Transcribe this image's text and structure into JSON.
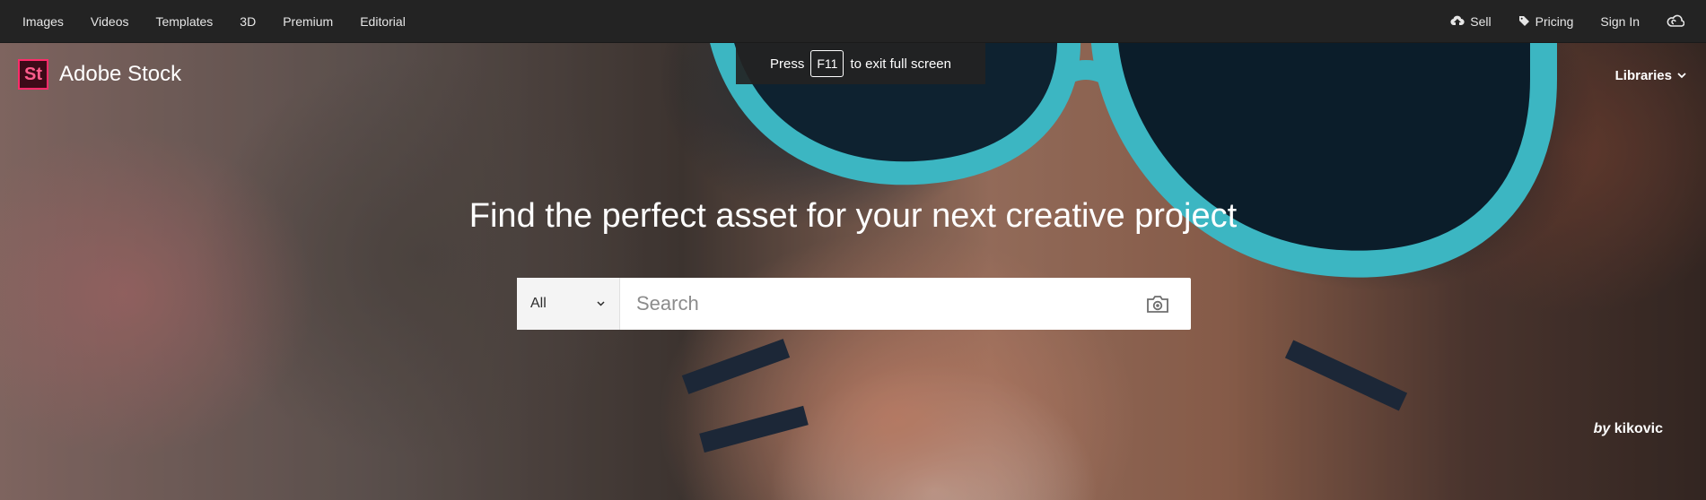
{
  "topnav": {
    "items": [
      "Images",
      "Videos",
      "Templates",
      "3D",
      "Premium",
      "Editorial"
    ]
  },
  "topright": {
    "sell": "Sell",
    "pricing": "Pricing",
    "signin": "Sign In",
    "icons": {
      "sell": "cloud-upload-icon",
      "pricing": "tag-icon",
      "cc": "creative-cloud-icon"
    }
  },
  "brand": {
    "logo": "St",
    "name": "Adobe Stock",
    "accent": "#ff2a6a"
  },
  "libraries": {
    "label": "Libraries"
  },
  "toast": {
    "press": "Press",
    "key": "F11",
    "rest": "to exit full screen"
  },
  "hero": {
    "headline": "Find the perfect asset for your next creative project"
  },
  "search": {
    "category": "All",
    "placeholder": "Search",
    "camera_icon": "camera-icon"
  },
  "credit": {
    "by": "by",
    "author": "kikovic"
  }
}
